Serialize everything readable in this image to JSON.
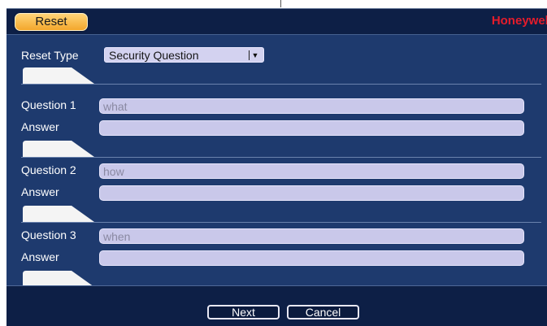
{
  "header": {
    "tab_label": "Reset",
    "logo_text": "Honeywell"
  },
  "form": {
    "reset_type_label": "Reset Type",
    "reset_type_value": "Security Question",
    "questions": [
      {
        "label": "Question 1",
        "value": "what",
        "answer_label": "Answer",
        "answer_value": ""
      },
      {
        "label": "Question 2",
        "value": "how",
        "answer_label": "Answer",
        "answer_value": ""
      },
      {
        "label": "Question 3",
        "value": "when",
        "answer_label": "Answer",
        "answer_value": ""
      }
    ]
  },
  "footer": {
    "next_label": "Next",
    "cancel_label": "Cancel"
  },
  "colors": {
    "panel_bg": "#1e3a6e",
    "header_bg": "#0d1f46",
    "tab_accent": "#f3a72c",
    "logo": "#e51c2b",
    "field_bg": "#c9c8ea"
  }
}
